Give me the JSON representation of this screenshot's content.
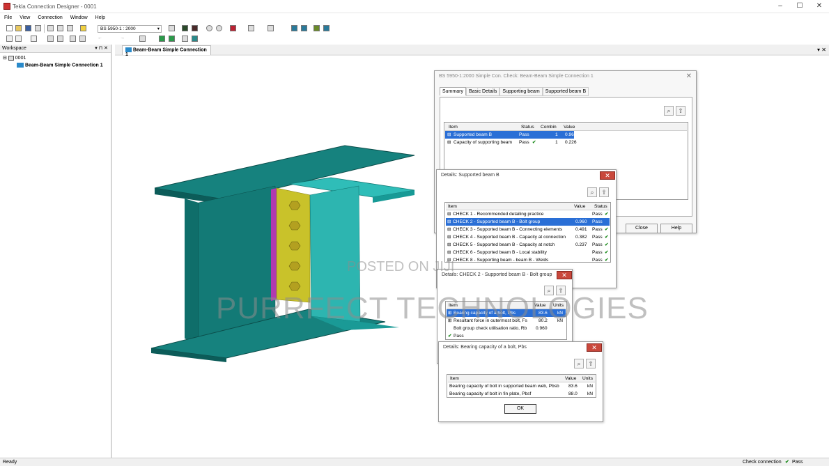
{
  "window": {
    "title": "Tekla Connection Designer - 0001",
    "min": "–",
    "max": "☐",
    "close": "✕"
  },
  "menu": [
    "File",
    "View",
    "Connection",
    "Window",
    "Help"
  ],
  "toolbar": {
    "code_select": "BS 5950-1 : 2000",
    "code_arrow": "▾"
  },
  "workspace": {
    "title": "Workspace",
    "pin": "▾ ⊓ ✕",
    "tree_root": "0001",
    "tree_item": "Beam-Beam Simple Connection 1"
  },
  "doc_tab": {
    "label": "Beam-Beam Simple Connection 1",
    "controls": "▾ ✕"
  },
  "summary_dialog": {
    "title": "BS 5950-1:2000 Simple Con. Check: Beam-Beam Simple Connection 1",
    "tabs": [
      "Summary",
      "Basic Details",
      "Supporting beam",
      "Supported beam B"
    ],
    "headers": [
      "Item",
      "Status",
      "Combin",
      "Value"
    ],
    "rows": [
      {
        "exp": "⊞",
        "item": "Supported beam B",
        "status": "Pass",
        "check": "",
        "combin": "1",
        "value": "0.960"
      },
      {
        "exp": "⊞",
        "item": "Capacity of supporting beam",
        "status": "Pass",
        "check": "✔",
        "combin": "1",
        "value": "0.226"
      }
    ],
    "close_button": "Close",
    "help_button": "Help"
  },
  "details_b": {
    "title": "Details: Supported beam B",
    "headers": [
      "Item",
      "Value",
      "Status"
    ],
    "rows": [
      {
        "exp": "⊞",
        "item": "CHECK 1 - Recommended detailing practice",
        "value": "",
        "status": "Pass",
        "check": "✔"
      },
      {
        "exp": "⊞",
        "item": "CHECK 2 - Supported beam B  - Bolt group",
        "value": "0.960",
        "status": "Pass",
        "check": ""
      },
      {
        "exp": "⊞",
        "item": "CHECK 3 - Supported beam B  - Connecting elements",
        "value": "0.491",
        "status": "Pass",
        "check": "✔"
      },
      {
        "exp": "⊞",
        "item": "CHECK 4 - Supported beam B  - Capacity at connection",
        "value": "0.382",
        "status": "Pass",
        "check": "✔"
      },
      {
        "exp": "⊞",
        "item": "CHECK 5 - Supported beam B  - Capacity at notch",
        "value": "0.237",
        "status": "Pass",
        "check": "✔"
      },
      {
        "exp": "⊞",
        "item": "CHECK 6 - Supported beam B  - Local stability",
        "value": "",
        "status": "Pass",
        "check": "✔"
      },
      {
        "exp": "⊞",
        "item": "CHECK 8 - Supporting beam - beam B  - Welds",
        "value": "",
        "status": "Pass",
        "check": "✔"
      }
    ]
  },
  "details_check2": {
    "title": "Details: CHECK 2 - Supported beam B  - Bolt group",
    "headers": [
      "Item",
      "Value",
      "Units"
    ],
    "rows": [
      {
        "exp": "⊞",
        "item": "Bearing capacity of a bolt, Pbs",
        "value": "83.6",
        "units": "kN"
      },
      {
        "exp": "⊞",
        "item": "Resultant force in outermost bolt, Fs",
        "value": "80.2",
        "units": "kN"
      },
      {
        "exp": "",
        "item": "Bolt group check utilisation ratio, Rb",
        "value": "0.960",
        "units": ""
      }
    ],
    "pass": "Pass"
  },
  "details_bearing": {
    "title": "Details: Bearing capacity of a bolt, Pbs",
    "headers": [
      "Item",
      "Value",
      "Units"
    ],
    "rows": [
      {
        "item": "Bearing capacity of bolt in supported beam web, Pbsb",
        "value": "83.6",
        "units": "kN"
      },
      {
        "item": "Bearing capacity of bolt in fin plate, Pbsf",
        "value": "88.0",
        "units": "kN"
      }
    ],
    "ok_button": "OK"
  },
  "watermark": {
    "line1": "POSTED ON JIJI",
    "line2": "PURRFECT TECHNOLOGIES"
  },
  "status": {
    "left": "Ready",
    "right": "Check connection",
    "right_status": "Pass"
  },
  "colors": {
    "beam_top": "#1a8a86",
    "beam_side": "#0f6e6a",
    "plate": "#c9c22a",
    "weld": "#b03ab0",
    "select": "#2a6fd6"
  },
  "icons": {
    "search": "🔍",
    "pin": "📌",
    "check": "✔"
  }
}
